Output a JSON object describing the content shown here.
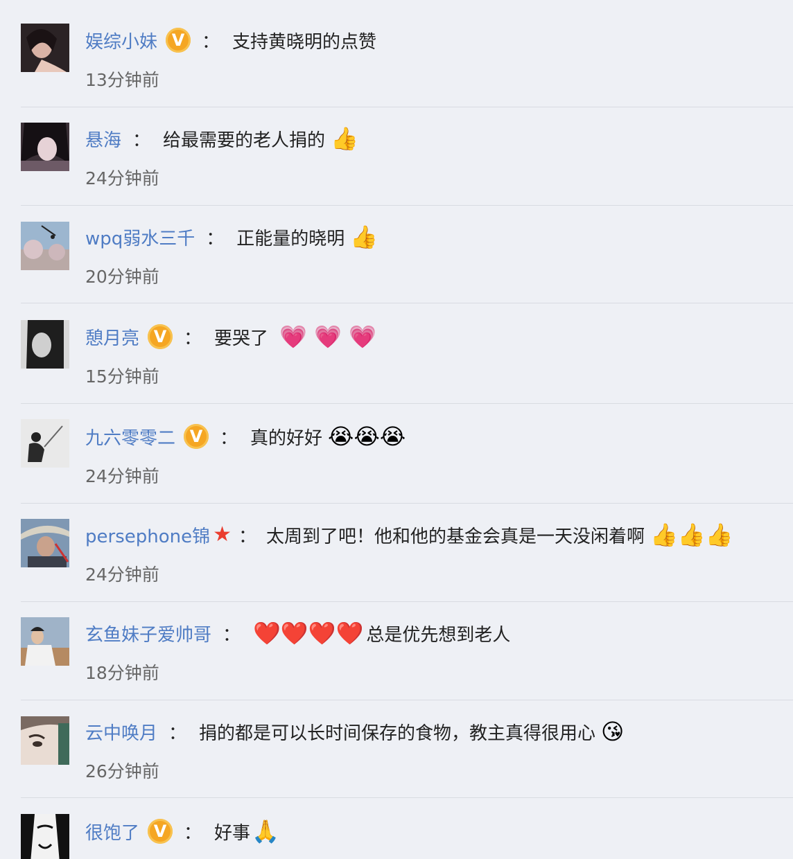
{
  "comments": [
    {
      "user": "娱综小妹",
      "verified": true,
      "star": false,
      "text": "支持黄晓明的点赞",
      "emoji_before": "",
      "emoji_after": "",
      "time": "13分钟前"
    },
    {
      "user": "悬海",
      "verified": false,
      "star": false,
      "text": "给最需要的老人捐的",
      "emoji_before": "",
      "emoji_after": "👍",
      "time": "24分钟前"
    },
    {
      "user": "wpq弱水三千",
      "verified": false,
      "star": false,
      "text": "正能量的晓明",
      "emoji_before": "",
      "emoji_after": "👍",
      "time": "20分钟前"
    },
    {
      "user": "憩月亮",
      "verified": true,
      "star": false,
      "text": "要哭了",
      "emoji_before": "",
      "emoji_after": "💗 💗 💗",
      "time": "15分钟前"
    },
    {
      "user": "九六零零二",
      "verified": true,
      "star": false,
      "text": "真的好好",
      "emoji_before": "",
      "emoji_after": "😭😭😭",
      "time": "24分钟前"
    },
    {
      "user": "persephone锦",
      "verified": false,
      "star": true,
      "text": "太周到了吧！他和他的基金会真是一天没闲着啊",
      "emoji_before": "",
      "emoji_after": "👍👍👍",
      "time": "24分钟前"
    },
    {
      "user": "玄鱼妹子爱帅哥",
      "verified": false,
      "star": false,
      "text": "总是优先想到老人",
      "emoji_before": "❤️❤️❤️❤️",
      "emoji_after": "",
      "time": "18分钟前"
    },
    {
      "user": "云中唤月",
      "verified": false,
      "star": false,
      "text": "捐的都是可以长时间保存的食物，教主真得很用心",
      "emoji_before": "",
      "emoji_after": "😘",
      "time": "26分钟前"
    },
    {
      "user": "很饱了",
      "verified": true,
      "star": false,
      "text": "好事",
      "emoji_before": "",
      "emoji_after": "🙏",
      "time": ""
    }
  ],
  "labels": {
    "verified": "V",
    "colon": "：",
    "star": "★"
  }
}
